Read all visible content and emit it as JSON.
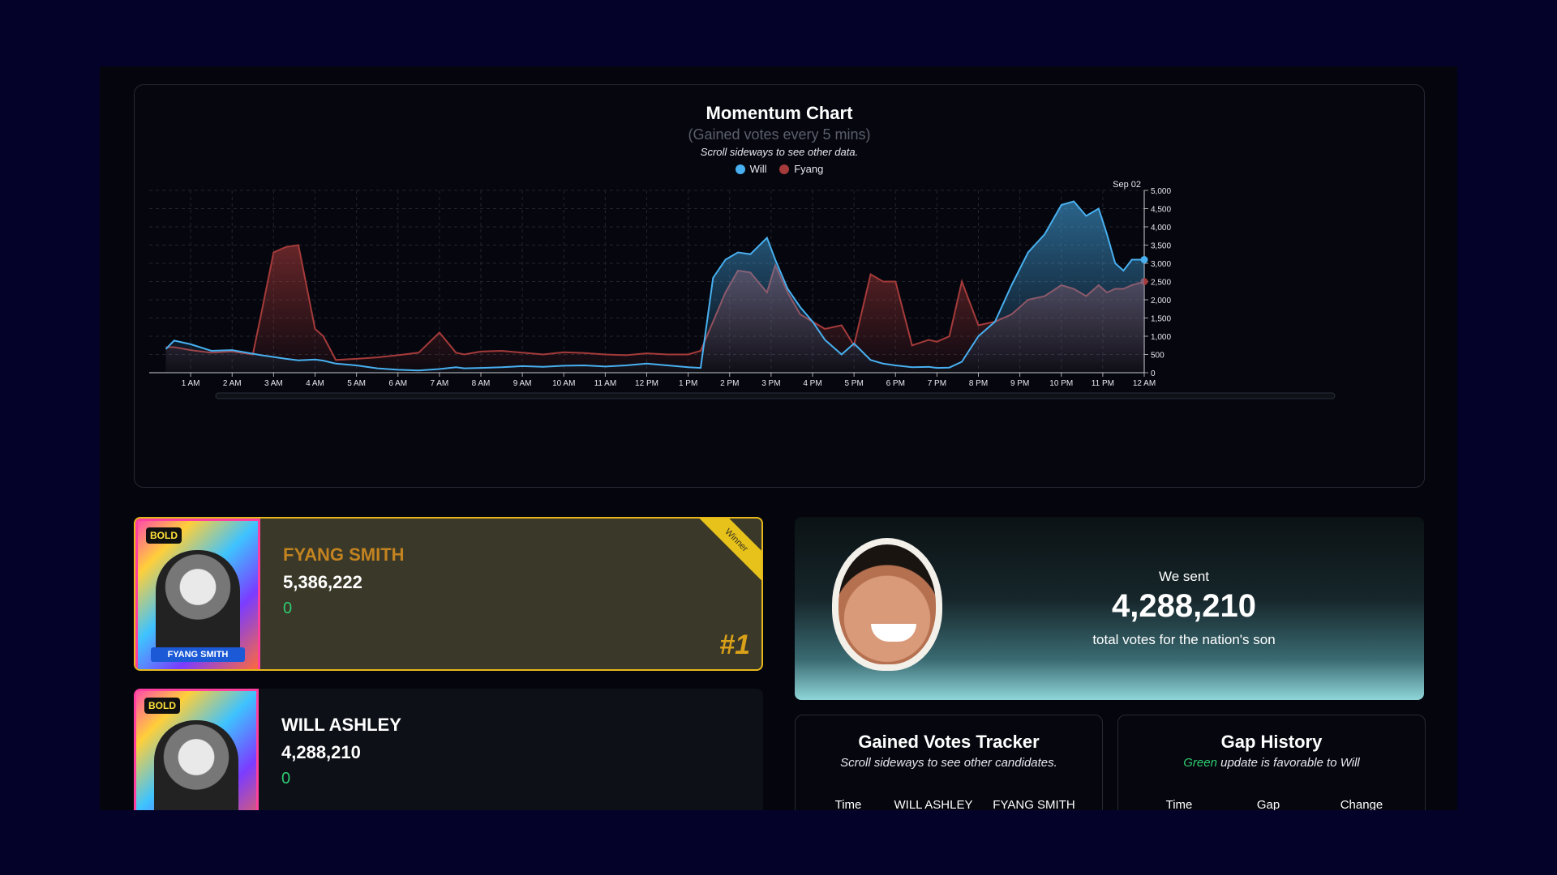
{
  "chart": {
    "title": "Momentum Chart",
    "subtitle": "(Gained votes every 5 mins)",
    "note": "Scroll sideways to see other data.",
    "date_label": "Sep 02"
  },
  "chart_data": {
    "type": "area",
    "x_ticks": [
      "1 AM",
      "2 AM",
      "3 AM",
      "4 AM",
      "5 AM",
      "6 AM",
      "7 AM",
      "8 AM",
      "9 AM",
      "10 AM",
      "11 AM",
      "12 PM",
      "1 PM",
      "2 PM",
      "3 PM",
      "4 PM",
      "5 PM",
      "6 PM",
      "7 PM",
      "8 PM",
      "9 PM",
      "10 PM",
      "11 PM",
      "12 AM"
    ],
    "y_ticks": [
      "0",
      "500",
      "1,000",
      "1,500",
      "2,000",
      "2,500",
      "3,000",
      "3,500",
      "4,000",
      "4,500",
      "5,000"
    ],
    "ylim": [
      0,
      5000
    ],
    "x_hours": [
      0.4,
      0.6,
      1,
      1.5,
      2,
      2.5,
      2.7,
      3,
      3.3,
      3.6,
      4,
      4.2,
      4.5,
      5,
      5.5,
      6,
      6.5,
      7,
      7.4,
      7.6,
      8,
      8.5,
      9,
      9.5,
      10,
      10.5,
      11,
      11.5,
      12,
      12.5,
      13,
      13.3,
      13.6,
      13.9,
      14.2,
      14.5,
      14.9,
      15.1,
      15.4,
      15.7,
      16,
      16.3,
      16.7,
      17,
      17.4,
      17.7,
      18,
      18.4,
      18.8,
      19,
      19.3,
      19.6,
      20,
      20.4,
      20.8,
      21.2,
      21.6,
      22,
      22.3,
      22.6,
      22.9,
      23.1,
      23.3,
      23.5,
      23.7,
      24
    ],
    "series": [
      {
        "name": "Will",
        "color": "#48b0f0",
        "values": [
          650,
          880,
          780,
          600,
          620,
          520,
          480,
          430,
          380,
          340,
          360,
          330,
          250,
          200,
          120,
          80,
          60,
          100,
          150,
          120,
          130,
          150,
          180,
          160,
          190,
          200,
          170,
          200,
          250,
          200,
          150,
          130,
          2600,
          3100,
          3300,
          3250,
          3700,
          3100,
          2300,
          1800,
          1400,
          900,
          500,
          800,
          350,
          250,
          200,
          150,
          160,
          130,
          140,
          300,
          1000,
          1400,
          2400,
          3300,
          3800,
          4600,
          4700,
          4300,
          4500,
          3800,
          3000,
          2800,
          3100,
          3100
        ]
      },
      {
        "name": "Fyang",
        "color": "#a53a3a",
        "values": [
          700,
          700,
          620,
          550,
          580,
          500,
          1600,
          3300,
          3450,
          3500,
          1200,
          1000,
          350,
          380,
          420,
          480,
          550,
          1100,
          550,
          500,
          580,
          600,
          550,
          500,
          560,
          540,
          500,
          480,
          530,
          500,
          500,
          600,
          1400,
          2200,
          2800,
          2750,
          2200,
          2950,
          2200,
          1600,
          1400,
          1200,
          1300,
          750,
          2700,
          2500,
          2500,
          750,
          900,
          850,
          1000,
          2500,
          1300,
          1400,
          1600,
          2000,
          2100,
          2400,
          2300,
          2100,
          2400,
          2200,
          2300,
          2300,
          2400,
          2500
        ]
      }
    ]
  },
  "winner": {
    "name": "FYANG SMITH",
    "votes": "5,386,222",
    "gain": "0",
    "rank": "#1",
    "ribbon": "Winner",
    "poster_tag": "BOLD",
    "poster_name": "FYANG SMITH"
  },
  "second": {
    "name": "WILL ASHLEY",
    "votes": "4,288,210",
    "gain": "0",
    "poster_tag": "BOLD"
  },
  "sent": {
    "label": "We sent",
    "number": "4,288,210",
    "desc": "total votes for the nation's son"
  },
  "tracker": {
    "title": "Gained Votes Tracker",
    "note": "Scroll sideways to see other candidates.",
    "headers": [
      "Time",
      "WILL ASHLEY",
      "FYANG SMITH"
    ]
  },
  "gap": {
    "title": "Gap History",
    "note_green": "Green",
    "note_rest": " update is favorable to Will",
    "headers": [
      "Time",
      "Gap",
      "Change"
    ]
  }
}
